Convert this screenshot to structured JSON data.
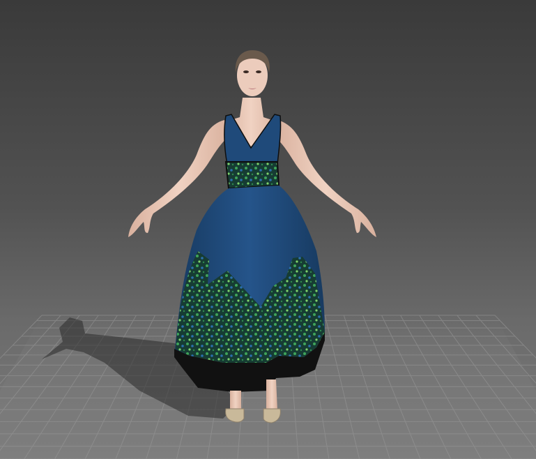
{
  "viewport": {
    "background_top": "#3a3a3a",
    "background_bottom": "#7d7d7d",
    "grid_color": "#9a9a9a"
  },
  "avatar": {
    "skin_color": "#e8c6b5",
    "hair_color": "#6a5a4c",
    "dress_color": "#1f4a7a",
    "print_color": "#1d5a3a",
    "hem_color": "#111111",
    "shoe_color": "#c9b99a"
  }
}
